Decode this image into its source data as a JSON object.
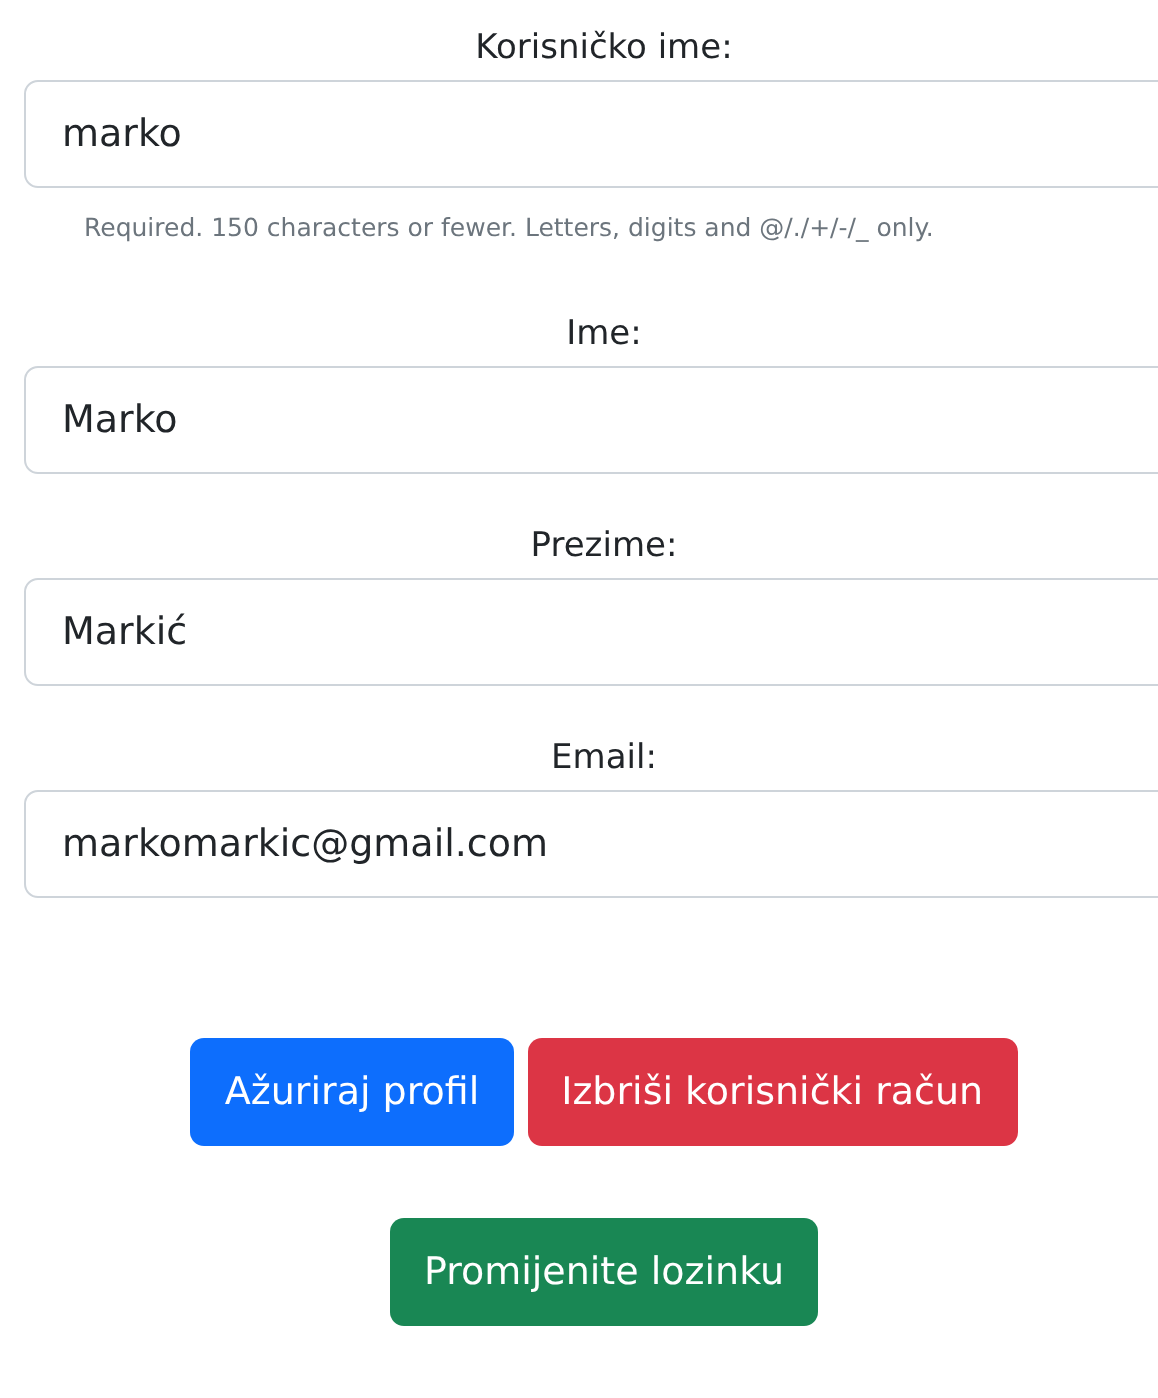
{
  "fields": [
    {
      "label": "Korisničko ime:",
      "value": "marko",
      "help": "Required. 150 characters or fewer. Letters, digits and @/./+/-/_ only."
    },
    {
      "label": "Ime:",
      "value": "Marko"
    },
    {
      "label": "Prezime:",
      "value": "Markić"
    },
    {
      "label": "Email:",
      "value": "markomarkic@gmail.com"
    }
  ],
  "button_rows": [
    [
      {
        "label": "Ažuriraj profil",
        "kind": "primary"
      },
      {
        "label": "Izbriši korisnički račun",
        "kind": "danger"
      }
    ],
    [
      {
        "label": "Promijenite lozinku",
        "kind": "success"
      }
    ]
  ]
}
